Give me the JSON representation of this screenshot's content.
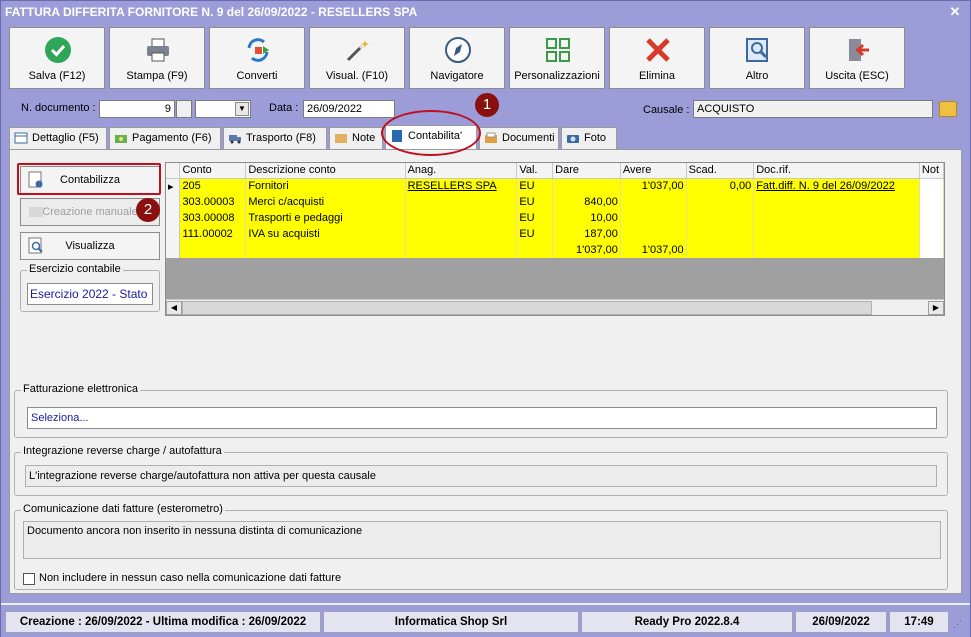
{
  "window": {
    "title": "FATTURA DIFFERITA FORNITORE N. 9 del 26/09/2022 - RESELLERS SPA"
  },
  "toolbar": {
    "buttons": [
      {
        "label": "Salva (F12)",
        "icon": "check-icon"
      },
      {
        "label": "Stampa (F9)",
        "icon": "printer-icon"
      },
      {
        "label": "Converti",
        "icon": "convert-icon"
      },
      {
        "label": "Visual. (F10)",
        "icon": "magic-wand-icon"
      },
      {
        "label": "Navigatore",
        "icon": "compass-icon"
      },
      {
        "label": "Personalizzazioni",
        "icon": "grid-icon"
      },
      {
        "label": "Elimina",
        "icon": "delete-x-icon"
      },
      {
        "label": "Altro",
        "icon": "magnifier-icon"
      },
      {
        "label": "Uscita (ESC)",
        "icon": "exit-door-icon"
      }
    ]
  },
  "header": {
    "doc_label": "N. documento :",
    "doc_number": "9",
    "date_label": "Data :",
    "date_value": "26/09/2022",
    "causale_label": "Causale :",
    "causale_value": "ACQUISTO"
  },
  "tabs": [
    {
      "label": "Dettaglio (F5)"
    },
    {
      "label": "Pagamento (F6)"
    },
    {
      "label": "Trasporto (F8)"
    },
    {
      "label": "Note"
    },
    {
      "label": "Contabilita'"
    },
    {
      "label": "Documenti"
    },
    {
      "label": "Foto"
    }
  ],
  "side": {
    "contabilizza": "Contabilizza",
    "creazione": "Creazione manuale",
    "visualizza": "Visualizza",
    "esercizio_title": "Esercizio contabile",
    "esercizio_value": "Esercizio 2022 - Stato"
  },
  "grid": {
    "columns": [
      "Conto",
      "Descrizione conto",
      "Anag.",
      "Val.",
      "Dare",
      "Avere",
      "Scad.",
      "Doc.rif.",
      "Not"
    ],
    "rows": [
      [
        "205",
        "Fornitori",
        "RESELLERS SPA",
        "EU",
        "",
        "1'037,00",
        "0,00",
        "Fatt.diff. N. 9 del 26/09/2022",
        ""
      ],
      [
        "303.00003",
        "Merci c/acquisti",
        "",
        "EU",
        "840,00",
        "",
        "",
        "",
        ""
      ],
      [
        "303.00008",
        "Trasporti e pedaggi",
        "",
        "EU",
        "10,00",
        "",
        "",
        "",
        ""
      ],
      [
        "111.00002",
        "IVA su acquisti",
        "",
        "EU",
        "187,00",
        "",
        "",
        "",
        ""
      ],
      [
        "",
        "",
        "",
        "",
        "1'037,00",
        "1'037,00",
        "",
        "",
        ""
      ]
    ]
  },
  "fattura_el": {
    "title": "Fatturazione elettronica",
    "value": "Seleziona..."
  },
  "reverse": {
    "title": "Integrazione reverse charge / autofattura",
    "value": "L'integrazione reverse charge/autofattura non attiva per questa causale"
  },
  "esterometro": {
    "title": "Comunicazione dati fatture (esterometro)",
    "value": "Documento ancora non inserito in nessuna distinta di comunicazione",
    "checkbox_label": "Non includere in nessun caso nella comunicazione dati fatture"
  },
  "annotations": {
    "badge1": "1",
    "badge2": "2"
  },
  "status": {
    "creation": "Creazione : 26/09/2022 - Ultima modifica : 26/09/2022",
    "company": "Informatica Shop Srl",
    "version": "Ready Pro 2022.8.4",
    "date": "26/09/2022",
    "time": "17:49"
  }
}
